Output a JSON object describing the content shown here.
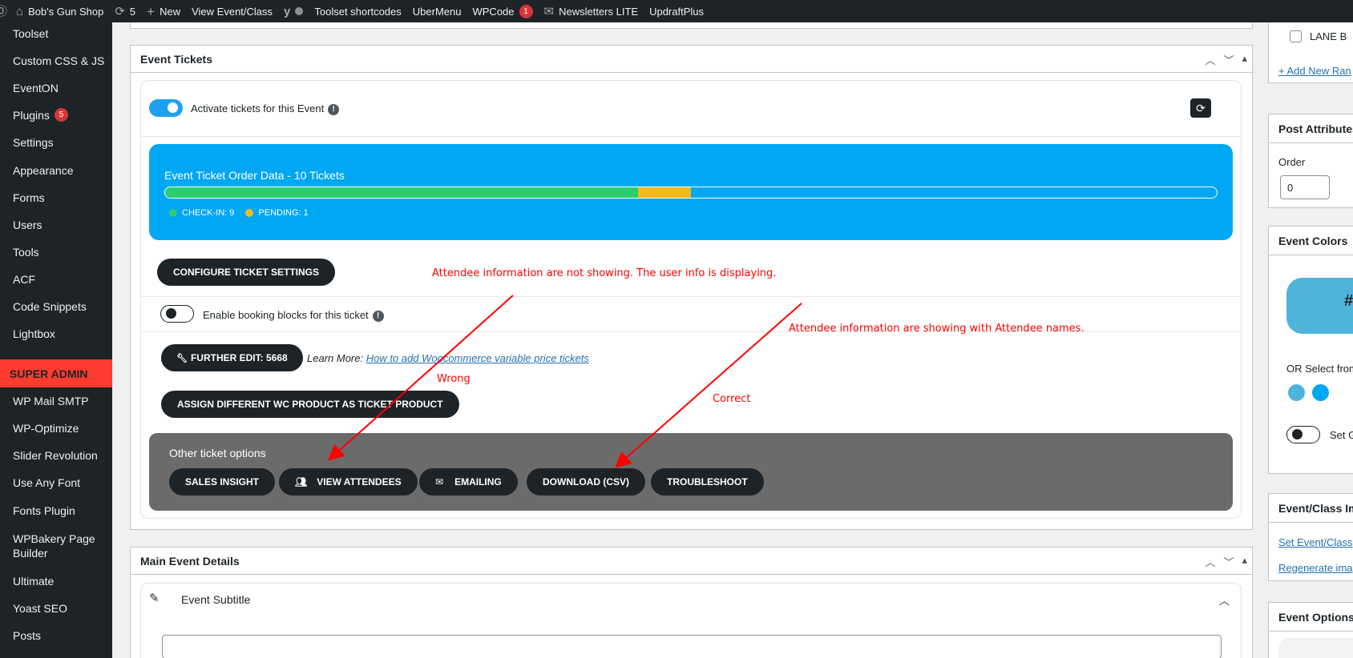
{
  "adminbar": {
    "site_name": "Bob's Gun Shop",
    "updates_count": "5",
    "new_label": "New",
    "view_label": "View Event/Class",
    "toolset_shortcodes": "Toolset shortcodes",
    "ubermenu": "UberMenu",
    "wpcode": "WPCode",
    "wpcode_badge": "1",
    "newsletters": "Newsletters LITE",
    "updraftplus": "UpdraftPlus"
  },
  "sidebar": {
    "items": [
      {
        "label": "Toolset"
      },
      {
        "label": "Custom CSS & JS"
      },
      {
        "label": "EventON"
      },
      {
        "label": "Plugins",
        "badge": "5"
      },
      {
        "label": "Settings"
      },
      {
        "label": "Appearance"
      },
      {
        "label": "Forms"
      },
      {
        "label": "Users"
      },
      {
        "label": "Tools"
      },
      {
        "label": "ACF"
      },
      {
        "label": "Code Snippets"
      },
      {
        "label": "Lightbox"
      },
      {
        "label": "WP Mail SMTP"
      },
      {
        "label": "WP-Optimize"
      },
      {
        "label": "Slider Revolution"
      },
      {
        "label": "Use Any Font"
      },
      {
        "label": "Fonts Plugin"
      },
      {
        "label": "WPBakery Page Builder"
      },
      {
        "label": "Ultimate"
      },
      {
        "label": "Yoast SEO"
      },
      {
        "label": "Posts"
      }
    ],
    "super_admin": "SUPER ADMIN"
  },
  "tickets": {
    "title": "Event Tickets",
    "activate_label": "Activate tickets for this Event",
    "order_title": "Event Ticket Order Data - 10 Tickets",
    "checkin_label": "CHECK-IN: 9",
    "pending_label": "PENDING: 1",
    "checkin_fraction": 0.45,
    "pending_fraction": 0.05,
    "configure_btn": "CONFIGURE TICKET SETTINGS",
    "booking_label": "Enable booking blocks for this ticket",
    "further_edit_btn": "FURTHER EDIT: 5668",
    "learn_more": "Learn More:",
    "learn_link": "How to add Woocommerce variable price tickets",
    "assign_btn": "ASSIGN DIFFERENT WC PRODUCT AS TICKET PRODUCT",
    "other_options_title": "Other ticket options",
    "options": [
      {
        "label": "SALES INSIGHT"
      },
      {
        "label": "VIEW ATTENDEES"
      },
      {
        "label": "EMAILING"
      },
      {
        "label": "DOWNLOAD (CSV)"
      },
      {
        "label": "TROUBLESHOOT"
      }
    ]
  },
  "annotations": {
    "wrong_note": "Attendee information are not showing. The user info is displaying.",
    "right_note": "Attendee information are showing with Attendee names.",
    "wrong": "Wrong",
    "correct": "Correct"
  },
  "main_details": {
    "title": "Main Event Details",
    "subtitle_label": "Event Subtitle"
  },
  "right": {
    "lane_b": "LANE B",
    "add_new": "+ Add New Ran",
    "post_attributes": "Post Attributes",
    "order_label": "Order",
    "order_value": "0",
    "event_colors": "Event Colors",
    "color_hash": "#",
    "or_select": "OR Select from",
    "set_g": "Set G",
    "event_image": "Event/Class Im",
    "set_image": "Set Event/Class",
    "regenerate": "Regenerate ima",
    "event_options": "Event Options"
  },
  "colors": {
    "checkin": "#2ecc71",
    "pending": "#f5b81c",
    "accent": "#00a7f2",
    "annotation": "#ff0000"
  }
}
